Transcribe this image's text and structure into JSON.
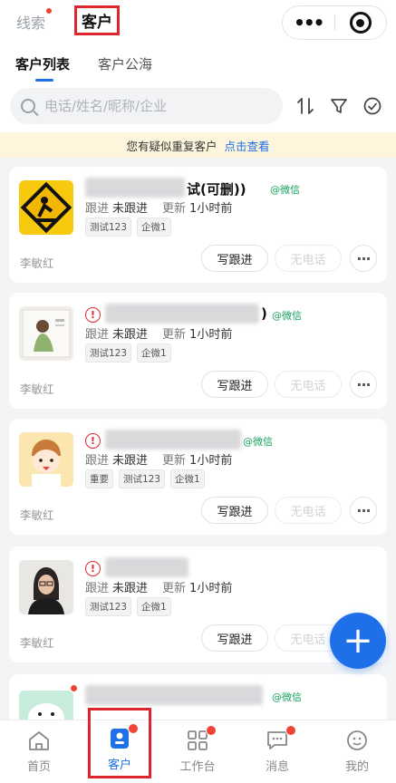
{
  "header": {
    "tab_clues": "线索",
    "tab_customers": "客户"
  },
  "subtabs": {
    "list": "客户列表",
    "pool": "客户公海"
  },
  "search": {
    "placeholder": "电话/姓名/昵称/企业"
  },
  "notice": {
    "text": "您有疑似重复客户",
    "link": "点击查看"
  },
  "customers": [
    {
      "name_visible": "试(可删))",
      "channel": "@微信",
      "follow_label": "跟进",
      "follow_value": "未跟进",
      "update_label": "更新",
      "update_value": "1小时前",
      "tags": [
        "测试123",
        "企微1"
      ],
      "owner": "李敏红",
      "warning": false
    },
    {
      "name_visible": ")",
      "channel": "@微信",
      "follow_label": "跟进",
      "follow_value": "未跟进",
      "update_label": "更新",
      "update_value": "1小时前",
      "tags": [
        "测试123",
        "企微1"
      ],
      "owner": "李敏红",
      "warning": true
    },
    {
      "name_visible": "",
      "channel": "@微信",
      "follow_label": "跟进",
      "follow_value": "未跟进",
      "update_label": "更新",
      "update_value": "1小时前",
      "tags": [
        "重要",
        "测试123",
        "企微1"
      ],
      "owner": "李敏红",
      "warning": true
    },
    {
      "name_visible": "",
      "channel": "",
      "follow_label": "跟进",
      "follow_value": "未跟进",
      "update_label": "更新",
      "update_value": "1小时前",
      "tags": [
        "测试123",
        "企微1"
      ],
      "owner": "李敏红",
      "warning": true
    },
    {
      "name_visible": "",
      "channel": "@微信",
      "owner": "",
      "warning": false
    }
  ],
  "card_actions": {
    "follow": "写跟进",
    "call": "无电话",
    "more": "···"
  },
  "fab": "+",
  "nav": {
    "home": "首页",
    "customers": "客户",
    "workbench": "工作台",
    "messages": "消息",
    "mine": "我的"
  },
  "colors": {
    "accent": "#1f6fe8",
    "highlight_box": "#e0262d",
    "wechat": "#17a05d",
    "badge": "#f04438"
  }
}
